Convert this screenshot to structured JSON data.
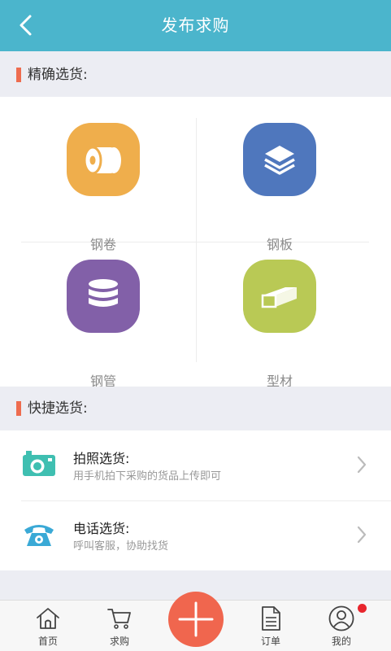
{
  "header": {
    "title": "发布求购"
  },
  "precise": {
    "title": "精确选货:",
    "items": [
      {
        "label": "钢卷",
        "color": "#efae4c",
        "icon": "steel-coil-icon"
      },
      {
        "label": "钢板",
        "color": "#4f77bd",
        "icon": "steel-plate-icon"
      },
      {
        "label": "钢管",
        "color": "#8260a8",
        "icon": "steel-pipe-icon"
      },
      {
        "label": "型材",
        "color": "#b9c955",
        "icon": "steel-profile-icon"
      }
    ]
  },
  "quick": {
    "title": "快捷选货:",
    "items": [
      {
        "title": "拍照选货:",
        "subtitle": "用手机拍下采购的货品上传即可",
        "icon": "camera-icon",
        "color": "#3fbfb1"
      },
      {
        "title": "电话选货:",
        "subtitle": "呼叫客服，协助找货",
        "icon": "phone-icon",
        "color": "#3aa9d6"
      }
    ]
  },
  "tabbar": {
    "items": [
      {
        "label": "首页",
        "icon": "home-icon"
      },
      {
        "label": "求购",
        "icon": "cart-icon"
      },
      {
        "label": "",
        "icon": "plus-icon"
      },
      {
        "label": "订单",
        "icon": "order-icon"
      },
      {
        "label": "我的",
        "icon": "profile-icon"
      }
    ],
    "accent": "#f0664e",
    "badge_color": "#e8262d"
  }
}
